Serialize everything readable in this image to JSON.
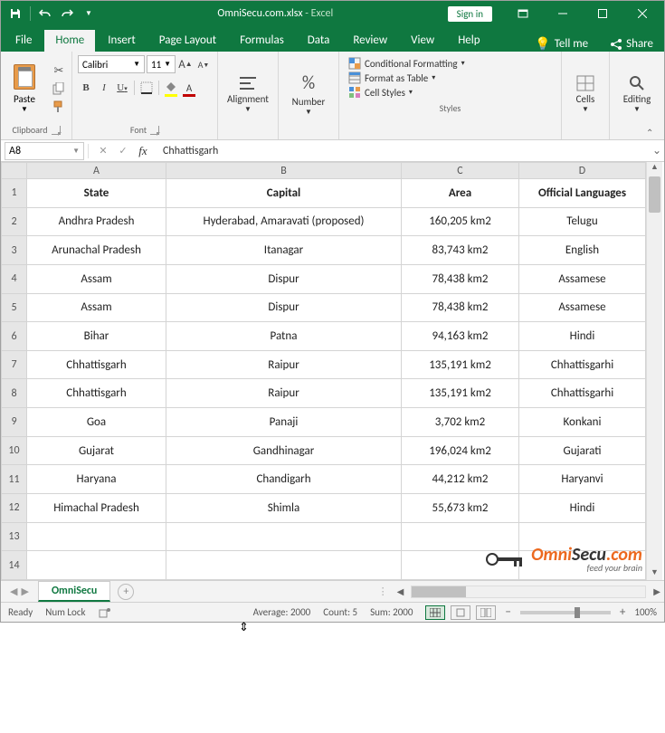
{
  "titlebar": {
    "filename": "OmniSecu.com.xlsx",
    "appname": "Excel",
    "signin": "Sign in"
  },
  "tabs": {
    "items": [
      "File",
      "Home",
      "Insert",
      "Page Layout",
      "Formulas",
      "Data",
      "Review",
      "View",
      "Help"
    ],
    "active": "Home",
    "tell_me": "Tell me",
    "share": "Share"
  },
  "ribbon": {
    "clipboard": {
      "paste": "Paste",
      "label": "Clipboard"
    },
    "font": {
      "name": "Calibri",
      "size": "11",
      "label": "Font"
    },
    "alignment": {
      "btn": "Alignment"
    },
    "number": {
      "btn": "Number"
    },
    "styles": {
      "cond": "Conditional Formatting",
      "table": "Format as Table",
      "cell": "Cell Styles",
      "label": "Styles"
    },
    "cells": {
      "btn": "Cells"
    },
    "editing": {
      "btn": "Editing"
    }
  },
  "fbar": {
    "namebox": "A8",
    "formula": "Chhattisgarh"
  },
  "grid": {
    "cols": [
      "A",
      "B",
      "C",
      "D"
    ],
    "rowcount": 14,
    "header": [
      "State",
      "Capital",
      "Area",
      "Official Languages"
    ],
    "rows": [
      [
        "Andhra Pradesh",
        "Hyderabad, Amaravati (proposed)",
        "160,205 km2",
        "Telugu"
      ],
      [
        "Arunachal Pradesh",
        "Itanagar",
        "83,743 km2",
        "English"
      ],
      [
        "Assam",
        "Dispur",
        "78,438 km2",
        "Assamese"
      ],
      [
        "Assam",
        "Dispur",
        "78,438 km2",
        "Assamese"
      ],
      [
        "Bihar",
        "Patna",
        "94,163 km2",
        "Hindi"
      ],
      [
        "Chhattisgarh",
        "Raipur",
        "135,191 km2",
        "Chhattisgarhi"
      ],
      [
        "Chhattisgarh",
        "Raipur",
        "135,191 km2",
        "Chhattisgarhi"
      ],
      [
        "Goa",
        "Panaji",
        "3,702 km2",
        "Konkani"
      ],
      [
        "Gujarat",
        "Gandhinagar",
        "196,024 km2",
        "Gujarati"
      ],
      [
        "Haryana",
        "Chandigarh",
        "44,212 km2",
        "Haryanvi"
      ],
      [
        "Himachal Pradesh",
        "Shimla",
        "55,673 km2",
        "Hindi"
      ]
    ]
  },
  "sheet_tabs": {
    "active": "OmniSecu"
  },
  "statusbar": {
    "ready": "Ready",
    "numlock": "Num Lock",
    "average": "Average: 2000",
    "count": "Count: 5",
    "sum": "Sum: 2000",
    "zoom": "100%"
  },
  "watermark": {
    "omni": "Omni",
    "secu": "Secu",
    "com": ".com",
    "sub": "feed your brain"
  }
}
